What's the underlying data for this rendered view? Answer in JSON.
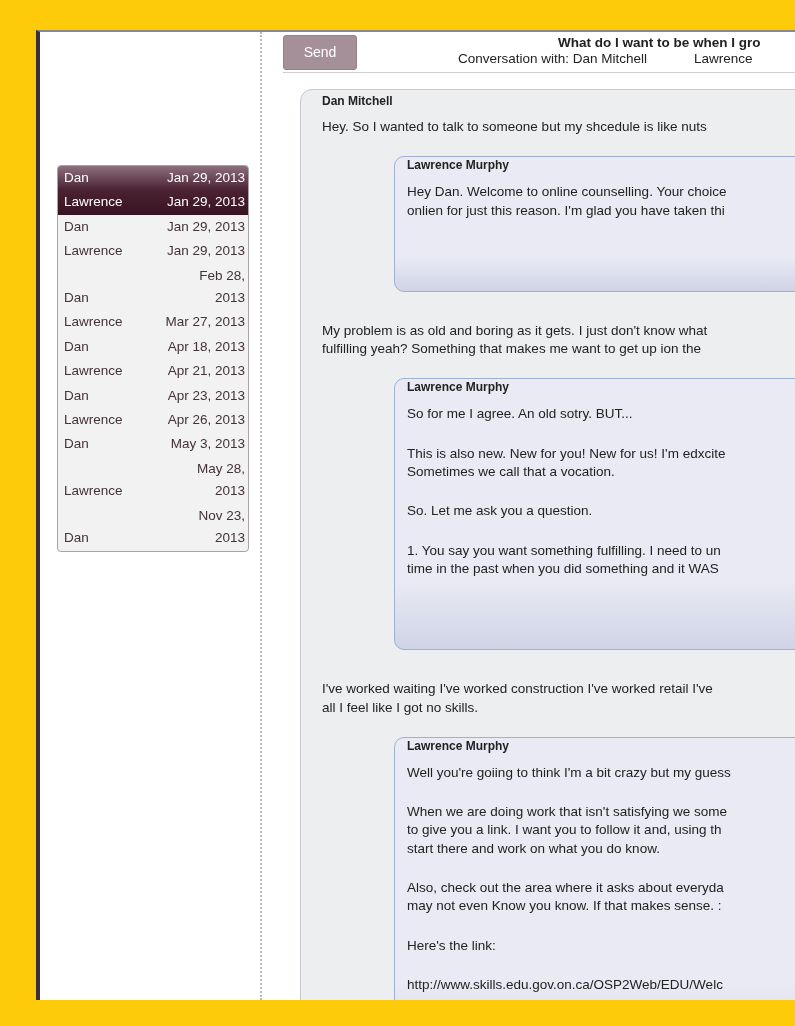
{
  "toolbar": {
    "send_button": "Send"
  },
  "header": {
    "title": "What do I want to be when I gro",
    "conversation_with": "Conversation with: Dan Mitchell",
    "counsellor": "Lawrence"
  },
  "sessions": [
    {
      "name": "Dan",
      "date": [
        "Jan 29, 2013"
      ],
      "selected": true
    },
    {
      "name": "Lawrence",
      "date": [
        "Jan 29, 2013"
      ],
      "selected": true
    },
    {
      "name": "Dan",
      "date": [
        "Jan 29, 2013"
      ],
      "selected": false
    },
    {
      "name": "Lawrence",
      "date": [
        "Jan 29, 2013"
      ],
      "selected": false
    },
    {
      "name": "Dan",
      "date": [
        "Feb 28,",
        "2013"
      ],
      "selected": false
    },
    {
      "name": "Lawrence",
      "date": [
        "Mar 27, 2013"
      ],
      "selected": false
    },
    {
      "name": "Dan",
      "date": [
        "Apr 18, 2013"
      ],
      "selected": false
    },
    {
      "name": "Lawrence",
      "date": [
        "Apr 21, 2013"
      ],
      "selected": false
    },
    {
      "name": "Dan",
      "date": [
        "Apr 23, 2013"
      ],
      "selected": false
    },
    {
      "name": "Lawrence",
      "date": [
        "Apr 26, 2013"
      ],
      "selected": false
    },
    {
      "name": "Dan",
      "date": [
        "May 3, 2013"
      ],
      "selected": false
    },
    {
      "name": "Lawrence",
      "date": [
        "May 28,",
        "2013"
      ],
      "selected": false
    },
    {
      "name": "Dan",
      "date": [
        "Nov 23,",
        "2013"
      ],
      "selected": false
    }
  ],
  "thread": {
    "author": "Dan Mitchell",
    "items": [
      {
        "kind": "text",
        "paragraphs": [
          [
            "Hey. So I wanted to talk to someone but my shcedule is like nuts"
          ]
        ]
      },
      {
        "kind": "reply",
        "author": "Lawrence Murphy",
        "paragraphs": [
          [
            "Hey Dan. Welcome to online counselling. Your choice",
            "onlien for just this reason. I'm glad you have taken thi"
          ]
        ]
      },
      {
        "kind": "text",
        "paragraphs": [
          [
            "My problem is as old and boring as it gets. I just don't know what",
            "fulfilling yeah? Something that makes me want to get up ion the"
          ]
        ]
      },
      {
        "kind": "reply",
        "author": "Lawrence Murphy",
        "paragraphs": [
          [
            "So for me I agree. An old sotry. BUT..."
          ],
          [
            "This is also new. New for you! New for us! I'm edxcite",
            "Sometimes we call that a vocation."
          ],
          [
            "So. Let me ask you a question."
          ],
          [
            "1. You say you want something fulfilling. I need to un",
            "time in the past when you did something and it WAS"
          ]
        ]
      },
      {
        "kind": "text",
        "paragraphs": [
          [
            "I've worked waiting I've worked construction I've worked retail I've",
            "all I feel like I got no skills."
          ]
        ]
      },
      {
        "kind": "reply",
        "author": "Lawrence Murphy",
        "paragraphs": [
          [
            "Well you're goiing to think I'm a bit crazy but my guess"
          ],
          [
            "When we are doing work that isn't satisfying we some",
            "to give you a link. I want you to follow it and, using th",
            "start there and work on what you do know."
          ],
          [
            "Also, check out the area where it asks about everyda",
            "may not even Know you know. If that makes sense. :"
          ],
          [
            "Here's the link:"
          ],
          [
            "http://www.skills.edu.gov.on.ca/OSP2Web/EDU/Welc"
          ]
        ]
      }
    ]
  }
}
